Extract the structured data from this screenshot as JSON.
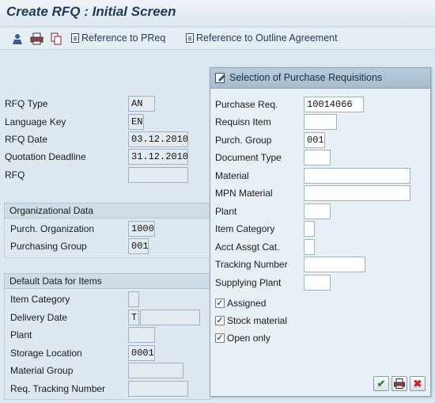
{
  "title": "Create RFQ : Initial Screen",
  "toolbar": {
    "icons": [
      "person-icon",
      "printer-icon",
      "copy-icon"
    ],
    "ref_preq_label": "Reference to PReq",
    "ref_outline_label": "Reference to Outline Agreement"
  },
  "header_fields": [
    {
      "label": "RFQ Type",
      "value": "AN"
    },
    {
      "label": "Language Key",
      "value": "EN"
    },
    {
      "label": "RFQ Date",
      "value": "03.12.2010"
    },
    {
      "label": "Quotation Deadline",
      "value": "31.12.2010"
    },
    {
      "label": "RFQ",
      "value": ""
    }
  ],
  "org_data": {
    "title": "Organizational Data",
    "fields": [
      {
        "label": "Purch. Organization",
        "value": "1000"
      },
      {
        "label": "Purchasing Group",
        "value": "001"
      }
    ]
  },
  "default_data": {
    "title": "Default Data for Items",
    "fields": [
      {
        "label": "Item Category",
        "value": ""
      },
      {
        "label": "Delivery Date",
        "value": "T",
        "value2": ""
      },
      {
        "label": "Plant",
        "value": ""
      },
      {
        "label": "Storage Location",
        "value": "0001"
      },
      {
        "label": "Material Group",
        "value": ""
      },
      {
        "label": "Req. Tracking Number",
        "value": ""
      }
    ]
  },
  "dialog": {
    "title": "Selection of Purchase Requisitions",
    "fields": [
      {
        "label": "Purchase Req.",
        "value": "10014066"
      },
      {
        "label": "Requisn Item",
        "value": ""
      },
      {
        "label": "Purch. Group",
        "value": "001"
      },
      {
        "label": "Document Type",
        "value": ""
      },
      {
        "label": "Material",
        "value": ""
      },
      {
        "label": "MPN Material",
        "value": ""
      },
      {
        "label": "Plant",
        "value": ""
      },
      {
        "label": "Item Category",
        "value": ""
      },
      {
        "label": "Acct Assgt Cat.",
        "value": ""
      },
      {
        "label": "Tracking Number",
        "value": ""
      },
      {
        "label": "Supplying Plant",
        "value": ""
      }
    ],
    "checkboxes": [
      {
        "label": "Assigned",
        "checked": true
      },
      {
        "label": "Stock material",
        "checked": true
      },
      {
        "label": "Open only",
        "checked": true
      }
    ],
    "buttons": [
      "confirm-icon",
      "copy-icon",
      "cancel-icon"
    ]
  },
  "colors": {
    "background": "#dde8f0",
    "title_text": "#1d3a5c",
    "dialog_titlebar": "#a7bccf",
    "cancel_red": "#c8231e",
    "confirm_green": "#2e8a1f"
  }
}
